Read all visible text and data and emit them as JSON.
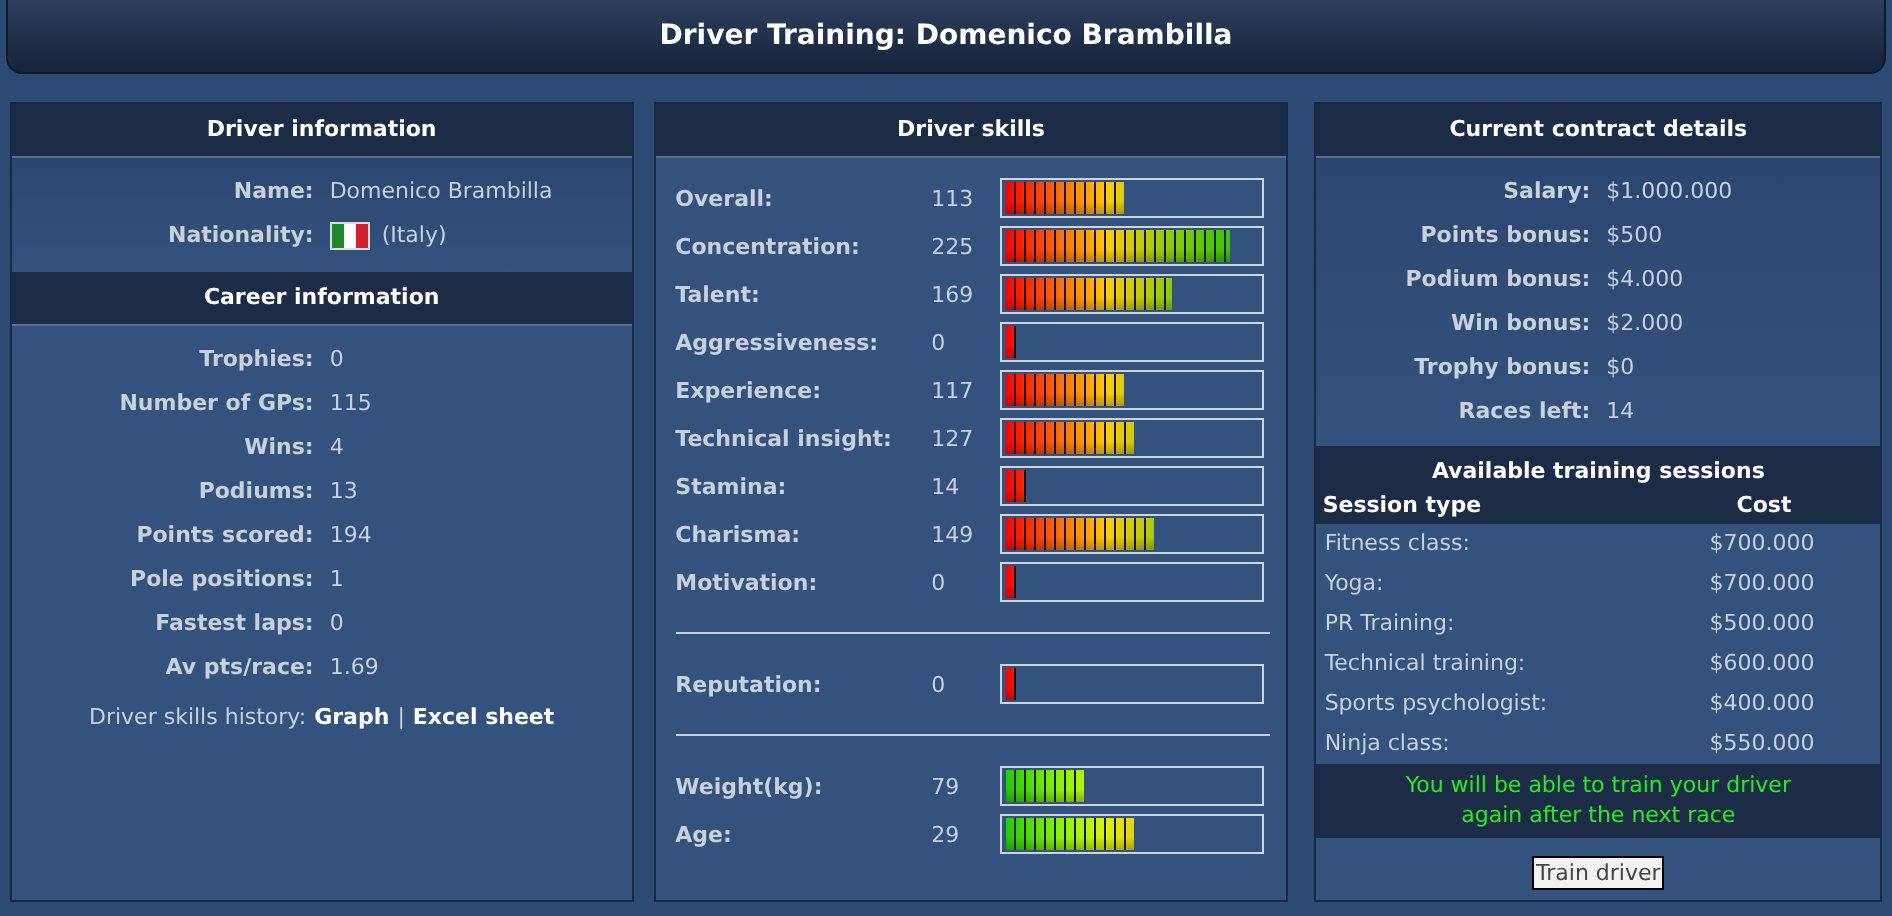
{
  "title": "Driver Training: Domenico Brambilla",
  "driver_info": {
    "heading": "Driver information",
    "name_label": "Name:",
    "name": "Domenico Brambilla",
    "nationality_label": "Nationality:",
    "nationality": "(Italy)"
  },
  "career": {
    "heading": "Career information",
    "stats": [
      {
        "label": "Trophies:",
        "value": "0"
      },
      {
        "label": "Number of GPs:",
        "value": "115"
      },
      {
        "label": "Wins:",
        "value": "4"
      },
      {
        "label": "Podiums:",
        "value": "13"
      },
      {
        "label": "Points scored:",
        "value": "194"
      },
      {
        "label": "Pole positions:",
        "value": "1"
      },
      {
        "label": "Fastest laps:",
        "value": "0"
      },
      {
        "label": "Av pts/race:",
        "value": "1.69"
      }
    ],
    "history_label": "Driver skills history:",
    "links": [
      "Graph",
      "Excel sheet"
    ],
    "separator": "|"
  },
  "skills": {
    "heading": "Driver skills",
    "sections": [
      {
        "kind": "skill",
        "rows": [
          {
            "label": "Overall:",
            "value": "113",
            "level": 0.46
          },
          {
            "label": "Concentration:",
            "value": "225",
            "level": 0.88
          },
          {
            "label": "Talent:",
            "value": "169",
            "level": 0.65
          },
          {
            "label": "Aggressiveness:",
            "value": "0",
            "level": 0.04
          },
          {
            "label": "Experience:",
            "value": "117",
            "level": 0.46
          },
          {
            "label": "Technical insight:",
            "value": "127",
            "level": 0.5
          },
          {
            "label": "Stamina:",
            "value": "14",
            "level": 0.08
          },
          {
            "label": "Charisma:",
            "value": "149",
            "level": 0.58
          },
          {
            "label": "Motivation:",
            "value": "0",
            "level": 0.04
          }
        ]
      },
      {
        "kind": "skill",
        "rows": [
          {
            "label": "Reputation:",
            "value": "0",
            "level": 0.04
          }
        ]
      },
      {
        "kind": "physical",
        "rows": [
          {
            "label": "Weight(kg):",
            "value": "79",
            "level": 0.31
          },
          {
            "label": "Age:",
            "value": "29",
            "level": 0.5
          }
        ]
      }
    ]
  },
  "contract": {
    "heading": "Current contract details",
    "items": [
      {
        "label": "Salary:",
        "value": "$1.000.000"
      },
      {
        "label": "Points bonus:",
        "value": "$500"
      },
      {
        "label": "Podium bonus:",
        "value": "$4.000"
      },
      {
        "label": "Win bonus:",
        "value": "$2.000"
      },
      {
        "label": "Trophy bonus:",
        "value": "$0"
      },
      {
        "label": "Races left:",
        "value": "14"
      }
    ]
  },
  "training": {
    "heading": "Available training sessions",
    "columns": [
      "Session type",
      "Cost"
    ],
    "sessions": [
      {
        "name": "Fitness class:",
        "cost": "$700.000"
      },
      {
        "name": "Yoga:",
        "cost": "$700.000"
      },
      {
        "name": "PR Training:",
        "cost": "$500.000"
      },
      {
        "name": "Technical training:",
        "cost": "$600.000"
      },
      {
        "name": "Sports psychologist:",
        "cost": "$400.000"
      },
      {
        "name": "Ninja class:",
        "cost": "$550.000"
      }
    ],
    "notice": "You will be able to train your driver again after the next race",
    "button": "Train driver"
  }
}
